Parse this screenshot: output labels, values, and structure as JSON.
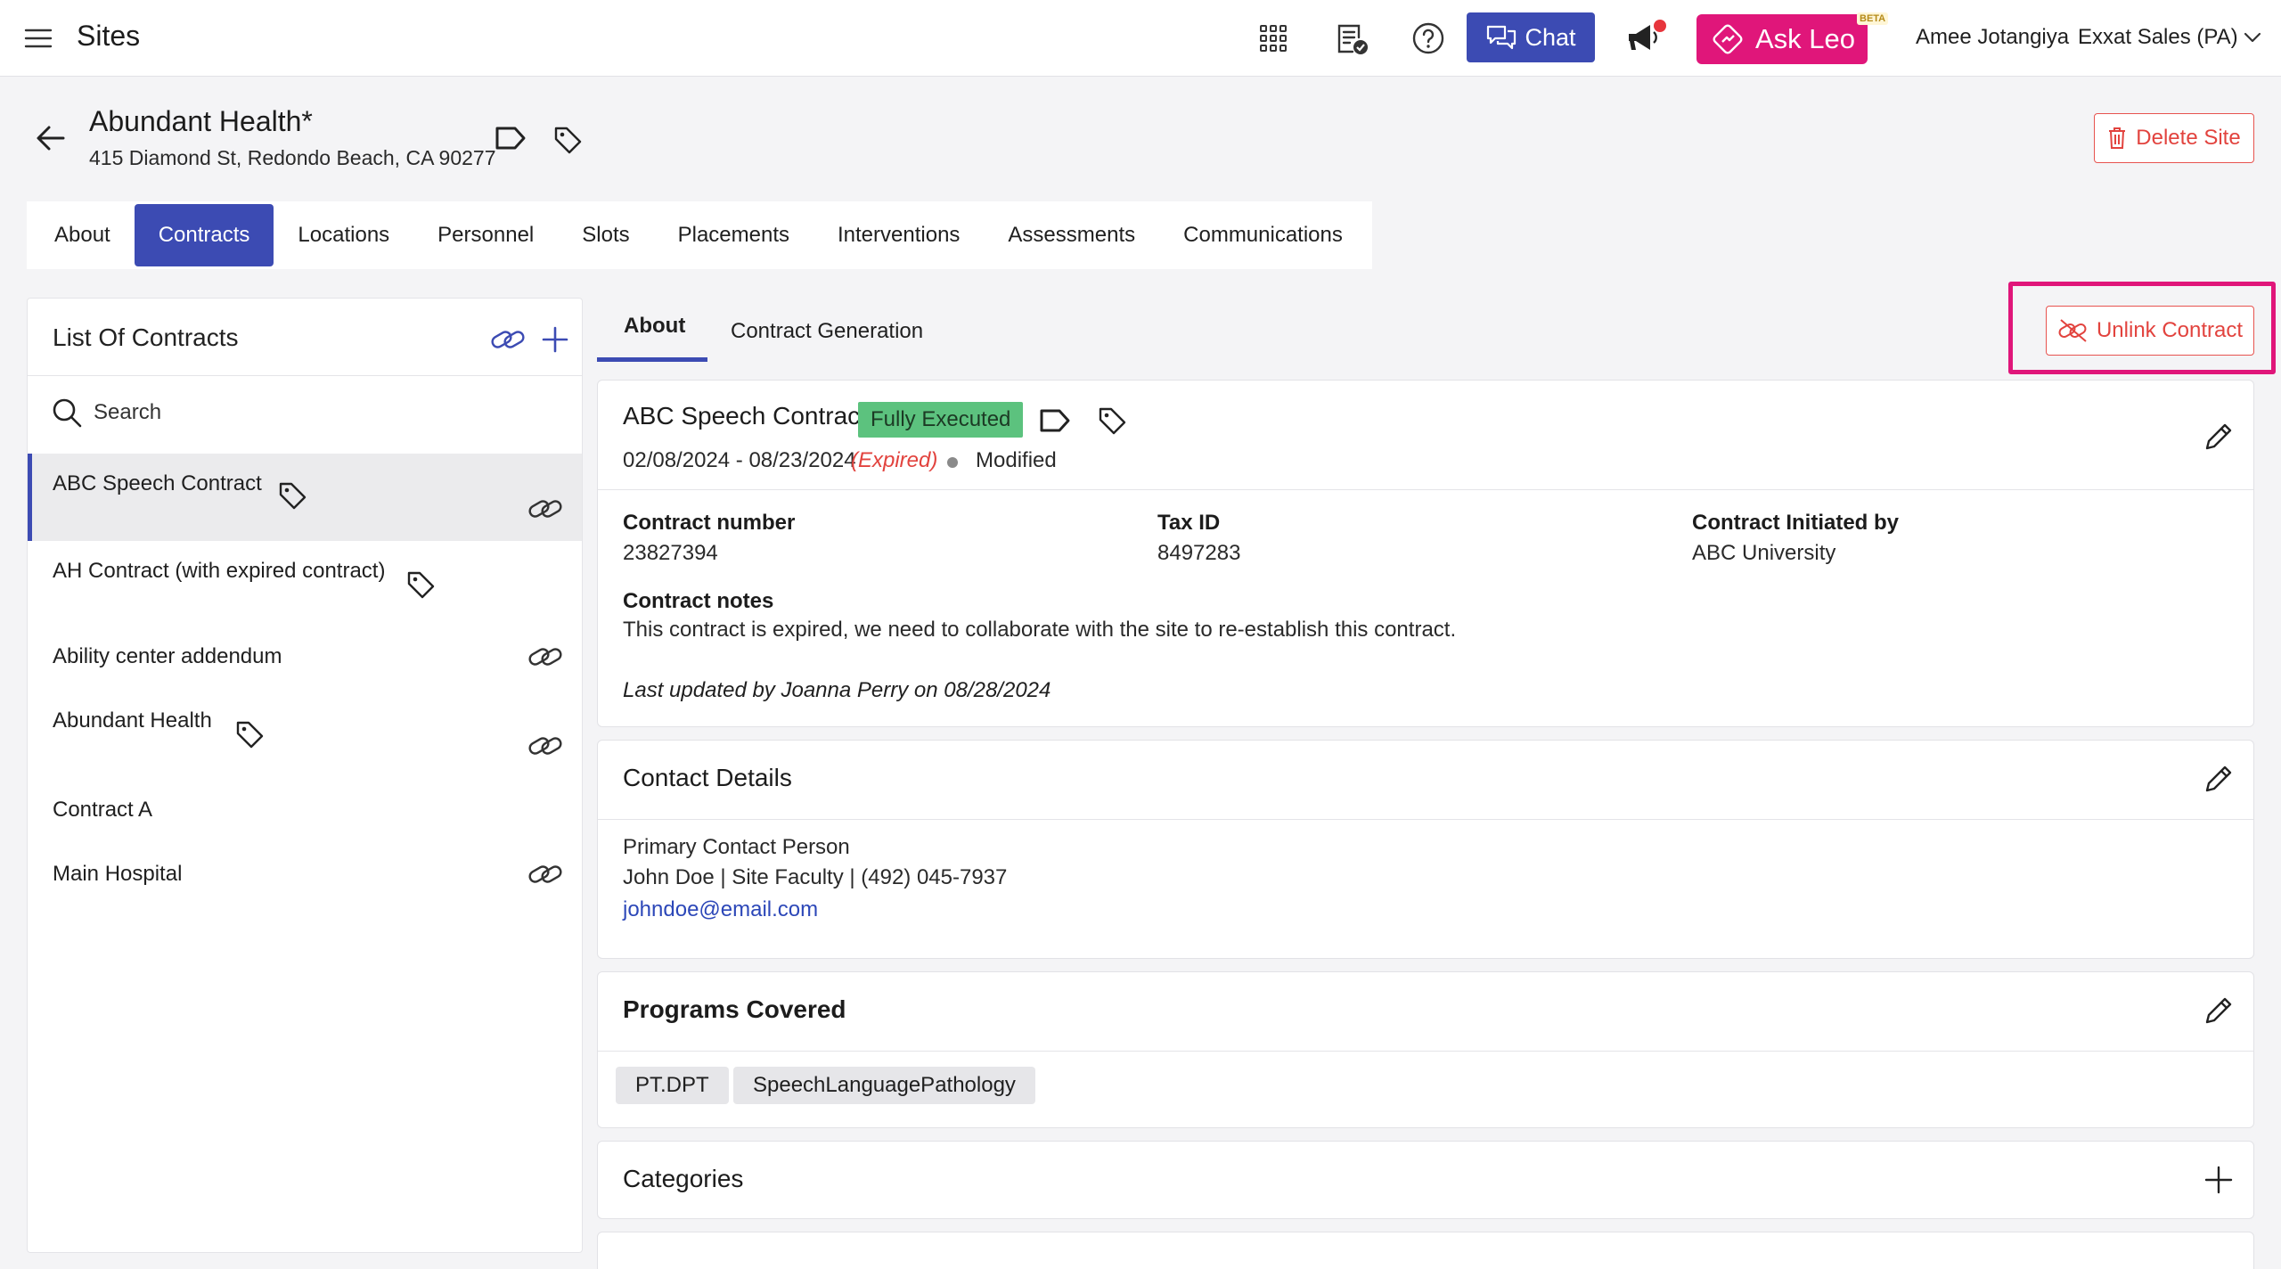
{
  "topbar": {
    "app_title": "Sites",
    "chat_label": "Chat",
    "ask_leo_label": "Ask Leo",
    "beta_badge": "BETA",
    "user_name": "Amee Jotangiya",
    "org_name": "Exxat Sales (PA)",
    "icons": [
      "menu-icon",
      "apps-grid-icon",
      "checklist-icon",
      "help-icon",
      "chat-icon",
      "megaphone-icon",
      "ask-leo-icon",
      "chevron-down-icon"
    ],
    "accent_color": "#3c4bb3",
    "ask_leo_color": "#e0167a"
  },
  "site": {
    "name": "Abundant Health*",
    "address": "415 Diamond St, Redondo Beach, CA 90277",
    "delete_label": "Delete Site"
  },
  "main_tabs": [
    {
      "label": "About",
      "active": false
    },
    {
      "label": "Contracts",
      "active": true
    },
    {
      "label": "Locations",
      "active": false
    },
    {
      "label": "Personnel",
      "active": false
    },
    {
      "label": "Slots",
      "active": false
    },
    {
      "label": "Placements",
      "active": false
    },
    {
      "label": "Interventions",
      "active": false
    },
    {
      "label": "Assessments",
      "active": false
    },
    {
      "label": "Communications",
      "active": false
    }
  ],
  "contracts_list": {
    "title": "List Of Contracts",
    "search_placeholder": "Search",
    "items": [
      {
        "name": "ABC Speech Contract",
        "tag": true,
        "linked": true,
        "selected": true
      },
      {
        "name": "AH Contract (with expired contract)",
        "tag": true,
        "linked": false,
        "selected": false
      },
      {
        "name": "Ability center addendum",
        "tag": false,
        "linked": true,
        "selected": false
      },
      {
        "name": "Abundant Health",
        "tag": true,
        "linked": true,
        "selected": false
      },
      {
        "name": "Contract A",
        "tag": false,
        "linked": false,
        "selected": false
      },
      {
        "name": "Main Hospital",
        "tag": false,
        "linked": true,
        "selected": false
      }
    ]
  },
  "sub_tabs": [
    {
      "label": "About",
      "active": true
    },
    {
      "label": "Contract Generation",
      "active": false
    }
  ],
  "unlink_label": "Unlink Contract",
  "contract": {
    "title": "ABC Speech Contract",
    "status": "Fully Executed",
    "status_color": "#5cc27e",
    "dates": "02/08/2024 - 08/23/2024",
    "expired": "(Expired)",
    "modified": "Modified",
    "fields": {
      "contract_number_label": "Contract number",
      "contract_number": "23827394",
      "tax_id_label": "Tax ID",
      "tax_id": "8497283",
      "initiated_by_label": "Contract Initiated by",
      "initiated_by": "ABC University",
      "notes_label": "Contract notes",
      "notes": "This contract is expired, we need to collaborate with the site to re-establish this contract."
    },
    "last_updated": "Last updated by Joanna Perry on 08/28/2024"
  },
  "contact_details": {
    "title": "Contact Details",
    "primary_label": "Primary Contact Person",
    "primary_info": "John Doe | Site Faculty | (492) 045-7937",
    "email": "johndoe@email.com"
  },
  "programs": {
    "title": "Programs Covered",
    "items": [
      "PT.DPT",
      "SpeechLanguagePathology"
    ]
  },
  "categories": {
    "title": "Categories"
  }
}
